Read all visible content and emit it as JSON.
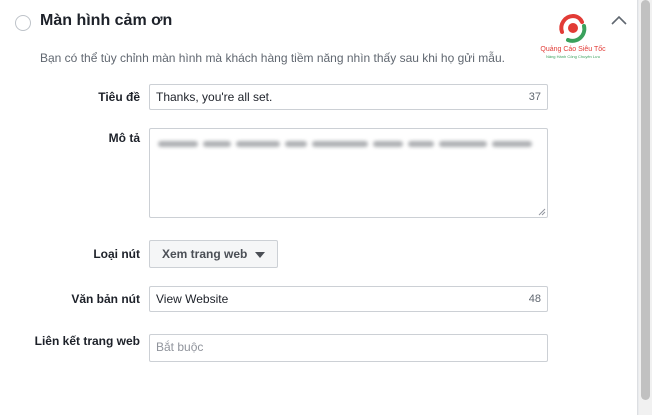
{
  "section": {
    "title": "Màn hình cảm ơn",
    "description": "Bạn có thể tùy chỉnh màn hình mà khách hàng tiềm năng nhìn thấy sau khi họ gửi mẫu."
  },
  "logo": {
    "name": "Quảng Cáo Siêu Tốc",
    "tagline": "Nâng Hành Công Chuyên Lưu"
  },
  "form": {
    "headline": {
      "label": "Tiêu đề",
      "value": "Thanks, you're all set.",
      "remaining": "37"
    },
    "description": {
      "label": "Mô tả"
    },
    "button_type": {
      "label": "Loại nút",
      "selected": "Xem trang web"
    },
    "button_text": {
      "label": "Văn bản nút",
      "value": "View Website",
      "remaining": "48"
    },
    "website_link": {
      "label": "Liên kết trang web",
      "placeholder": "Bắt buộc"
    }
  },
  "icons": {
    "radio": "radio-unselected-icon",
    "collapse": "chevron-up-icon",
    "dropdown": "caret-down-icon",
    "resize": "resize-grip-icon"
  },
  "colors": {
    "label": "#1d2129",
    "muted": "#606770",
    "border": "#ccd0d5",
    "logo_red": "#e23b36",
    "logo_green": "#3aa15c"
  }
}
